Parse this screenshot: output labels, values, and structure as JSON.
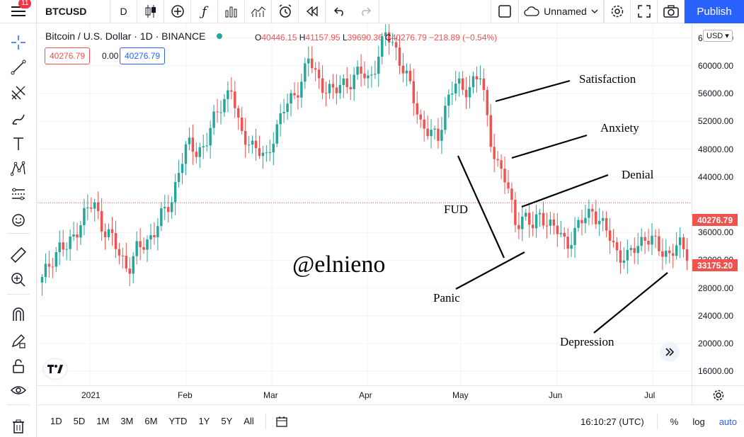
{
  "toolbar": {
    "notification_count": "11",
    "symbol": "BTCUSD",
    "interval": "D",
    "layout_name": "Unnamed",
    "publish_label": "Publish"
  },
  "legend": {
    "title": "Bitcoin / U.S. Dollar · 1D · BINANCE",
    "open_label": "O",
    "open": "40446.15",
    "high_label": "H",
    "high": "41157.95",
    "low_label": "L",
    "low": "39690.36",
    "close_label": "C",
    "close": "40276.79",
    "change": "−218.89 (−0.54%)",
    "sell_price": "40276.79",
    "spread": "0.00",
    "buy_price": "40276.79"
  },
  "price_axis": {
    "currency": "USD",
    "labels": [
      "64000.00",
      "60000.00",
      "56000.00",
      "52000.00",
      "48000.00",
      "44000.00",
      "36000.00",
      "32000.00",
      "28000.00",
      "24000.00",
      "20000.00",
      "16000.00"
    ],
    "last_price_tag": "40276.79",
    "current_price_tag": "33175.20"
  },
  "time_axis": {
    "labels": [
      "2021",
      "Feb",
      "Mar",
      "Apr",
      "May",
      "Jun",
      "Jul"
    ]
  },
  "bottom_bar": {
    "ranges": [
      "1D",
      "5D",
      "1M",
      "3M",
      "6M",
      "YTD",
      "1Y",
      "5Y",
      "All"
    ],
    "clock": "16:10:27 (UTC)",
    "percent": "%",
    "log": "log",
    "auto": "auto"
  },
  "annotations": {
    "watermark": "@elnieno",
    "satisfaction": "Satisfaction",
    "anxiety": "Anxiety",
    "denial": "Denial",
    "fud": "FUD",
    "panic": "Panic",
    "depression": "Depression"
  },
  "colors": {
    "up": "#26a69a",
    "down": "#ef5350",
    "accent": "#2962ff"
  },
  "chart_data": {
    "type": "candlestick",
    "title": "Bitcoin / U.S. Dollar · 1D · BINANCE",
    "ylim": [
      14000,
      66000
    ],
    "months": [
      "2021",
      "Feb",
      "Mar",
      "Apr",
      "May",
      "Jun",
      "Jul"
    ],
    "close_series": [
      29000,
      32000,
      34000,
      33500,
      36500,
      39000,
      40000,
      37000,
      35500,
      32500,
      31000,
      33500,
      34000,
      36500,
      38500,
      40000,
      46000,
      48500,
      47500,
      49000,
      52000,
      55000,
      57000,
      50000,
      49500,
      48000,
      46000,
      50500,
      53500,
      55000,
      57500,
      61000,
      58000,
      57000,
      56000,
      57500,
      58000,
      59000,
      58000,
      61000,
      64500,
      63000,
      59500,
      56000,
      52000,
      50500,
      49000,
      55000,
      57500,
      56000,
      58000,
      58500,
      50000,
      46000,
      43000,
      37500,
      38500,
      36500,
      39000,
      37000,
      36000,
      34500,
      36000,
      38000,
      39500,
      37000,
      35500,
      33000,
      32000,
      34000,
      35500,
      34500,
      33500,
      33000,
      34000,
      33175
    ]
  }
}
